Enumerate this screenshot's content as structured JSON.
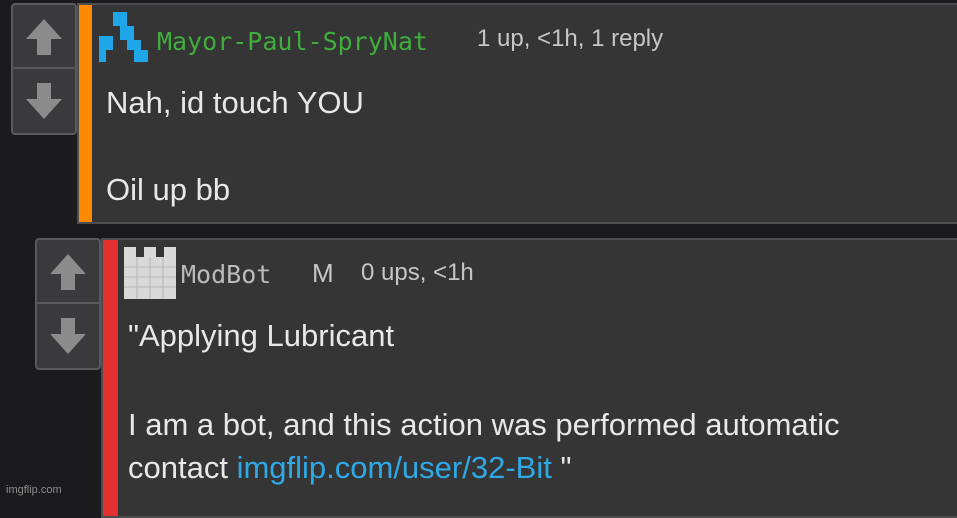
{
  "comment1": {
    "username": "Mayor-Paul-SpryNat",
    "meta": "1 up, <1h, 1 reply",
    "line1": "Nah, id touch YOU",
    "line2": "Oil up bb",
    "accent_color": "#ff8a00",
    "username_color": "#3fae3c"
  },
  "comment2": {
    "username": "ModBot",
    "mod_badge": "M",
    "meta": "0 ups, <1h",
    "line1": "\"Applying Lubricant",
    "line2": "I am a bot, and this action was performed automatic",
    "line3_prefix": "contact ",
    "link_text": "imgflip.com/user/32-Bit",
    "line3_suffix": " \"",
    "accent_color": "#e53030",
    "username_color": "#bbbbbb"
  },
  "icons": [
    "upvote-arrow-icon",
    "downvote-arrow-icon",
    "user-avatar-icon",
    "castle-avatar-icon"
  ],
  "watermark": "imgflip.com"
}
